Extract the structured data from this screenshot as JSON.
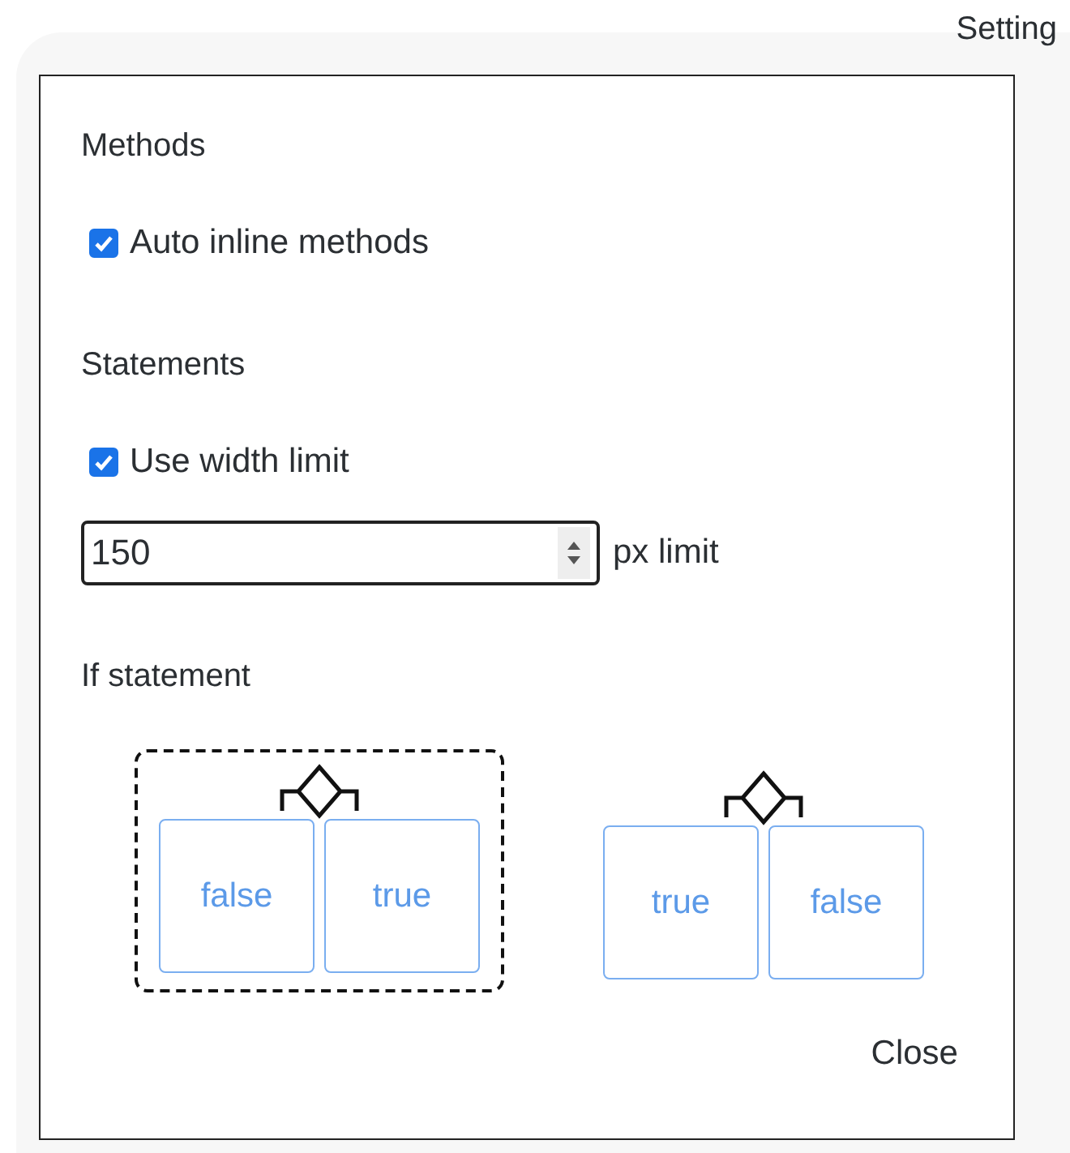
{
  "window": {
    "title": "Setting"
  },
  "sections": [
    {
      "kind": "checkboxes",
      "heading": "Methods",
      "checkbox": {
        "label": "Auto inline methods",
        "checked": true
      }
    },
    {
      "kind": "limit",
      "heading": "Statements",
      "checkbox": {
        "label": "Use width limit",
        "checked": true
      },
      "field": {
        "value": "150",
        "unit": "px limit"
      }
    },
    {
      "kind": "layouts",
      "heading": "If statement",
      "options": [
        {
          "selected": true,
          "branches": [
            "false",
            "true"
          ]
        },
        {
          "selected": false,
          "branches": [
            "true",
            "false"
          ]
        }
      ]
    }
  ],
  "buttons": [
    "Close"
  ]
}
